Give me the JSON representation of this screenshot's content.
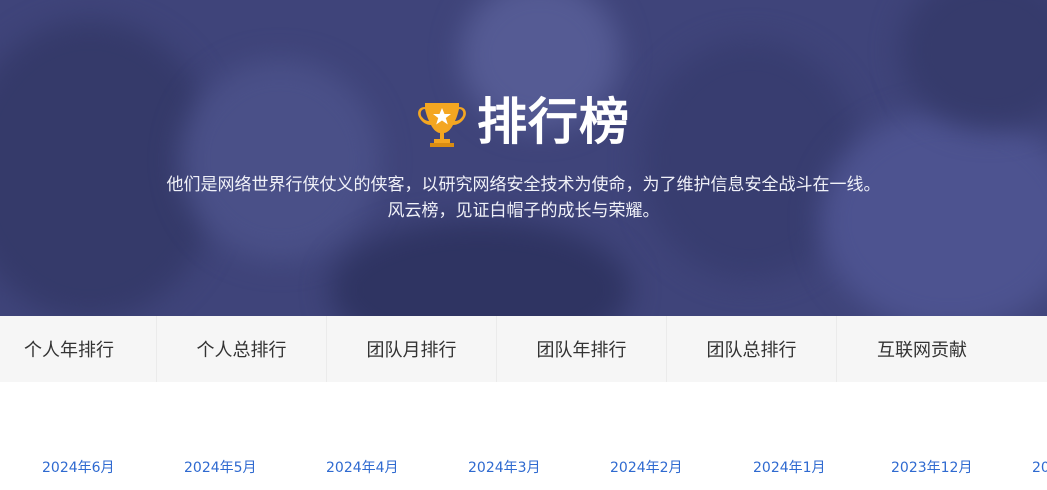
{
  "hero": {
    "title": "排行榜",
    "subtitle_line1": "他们是网络世界行侠仗义的侠客，以研究网络安全技术为使命，为了维护信息安全战斗在一线。",
    "subtitle_line2": "风云榜，见证白帽子的成长与荣耀。",
    "icon": "trophy-icon",
    "colors": {
      "overlay": "#3f447a",
      "trophy": "#f4a621"
    }
  },
  "tabs": [
    {
      "label": "个人年排行"
    },
    {
      "label": "个人总排行"
    },
    {
      "label": "团队月排行"
    },
    {
      "label": "团队年排行"
    },
    {
      "label": "团队总排行"
    },
    {
      "label": "互联网贡献"
    }
  ],
  "months": [
    {
      "label": "2024年6月"
    },
    {
      "label": "2024年5月"
    },
    {
      "label": "2024年4月"
    },
    {
      "label": "2024年3月"
    },
    {
      "label": "2024年2月"
    },
    {
      "label": "2024年1月"
    },
    {
      "label": "2023年12月"
    },
    {
      "label": "20"
    }
  ],
  "colors": {
    "link": "#2f6ad0",
    "tab_bg": "#f6f6f6",
    "tab_text": "#333333"
  }
}
